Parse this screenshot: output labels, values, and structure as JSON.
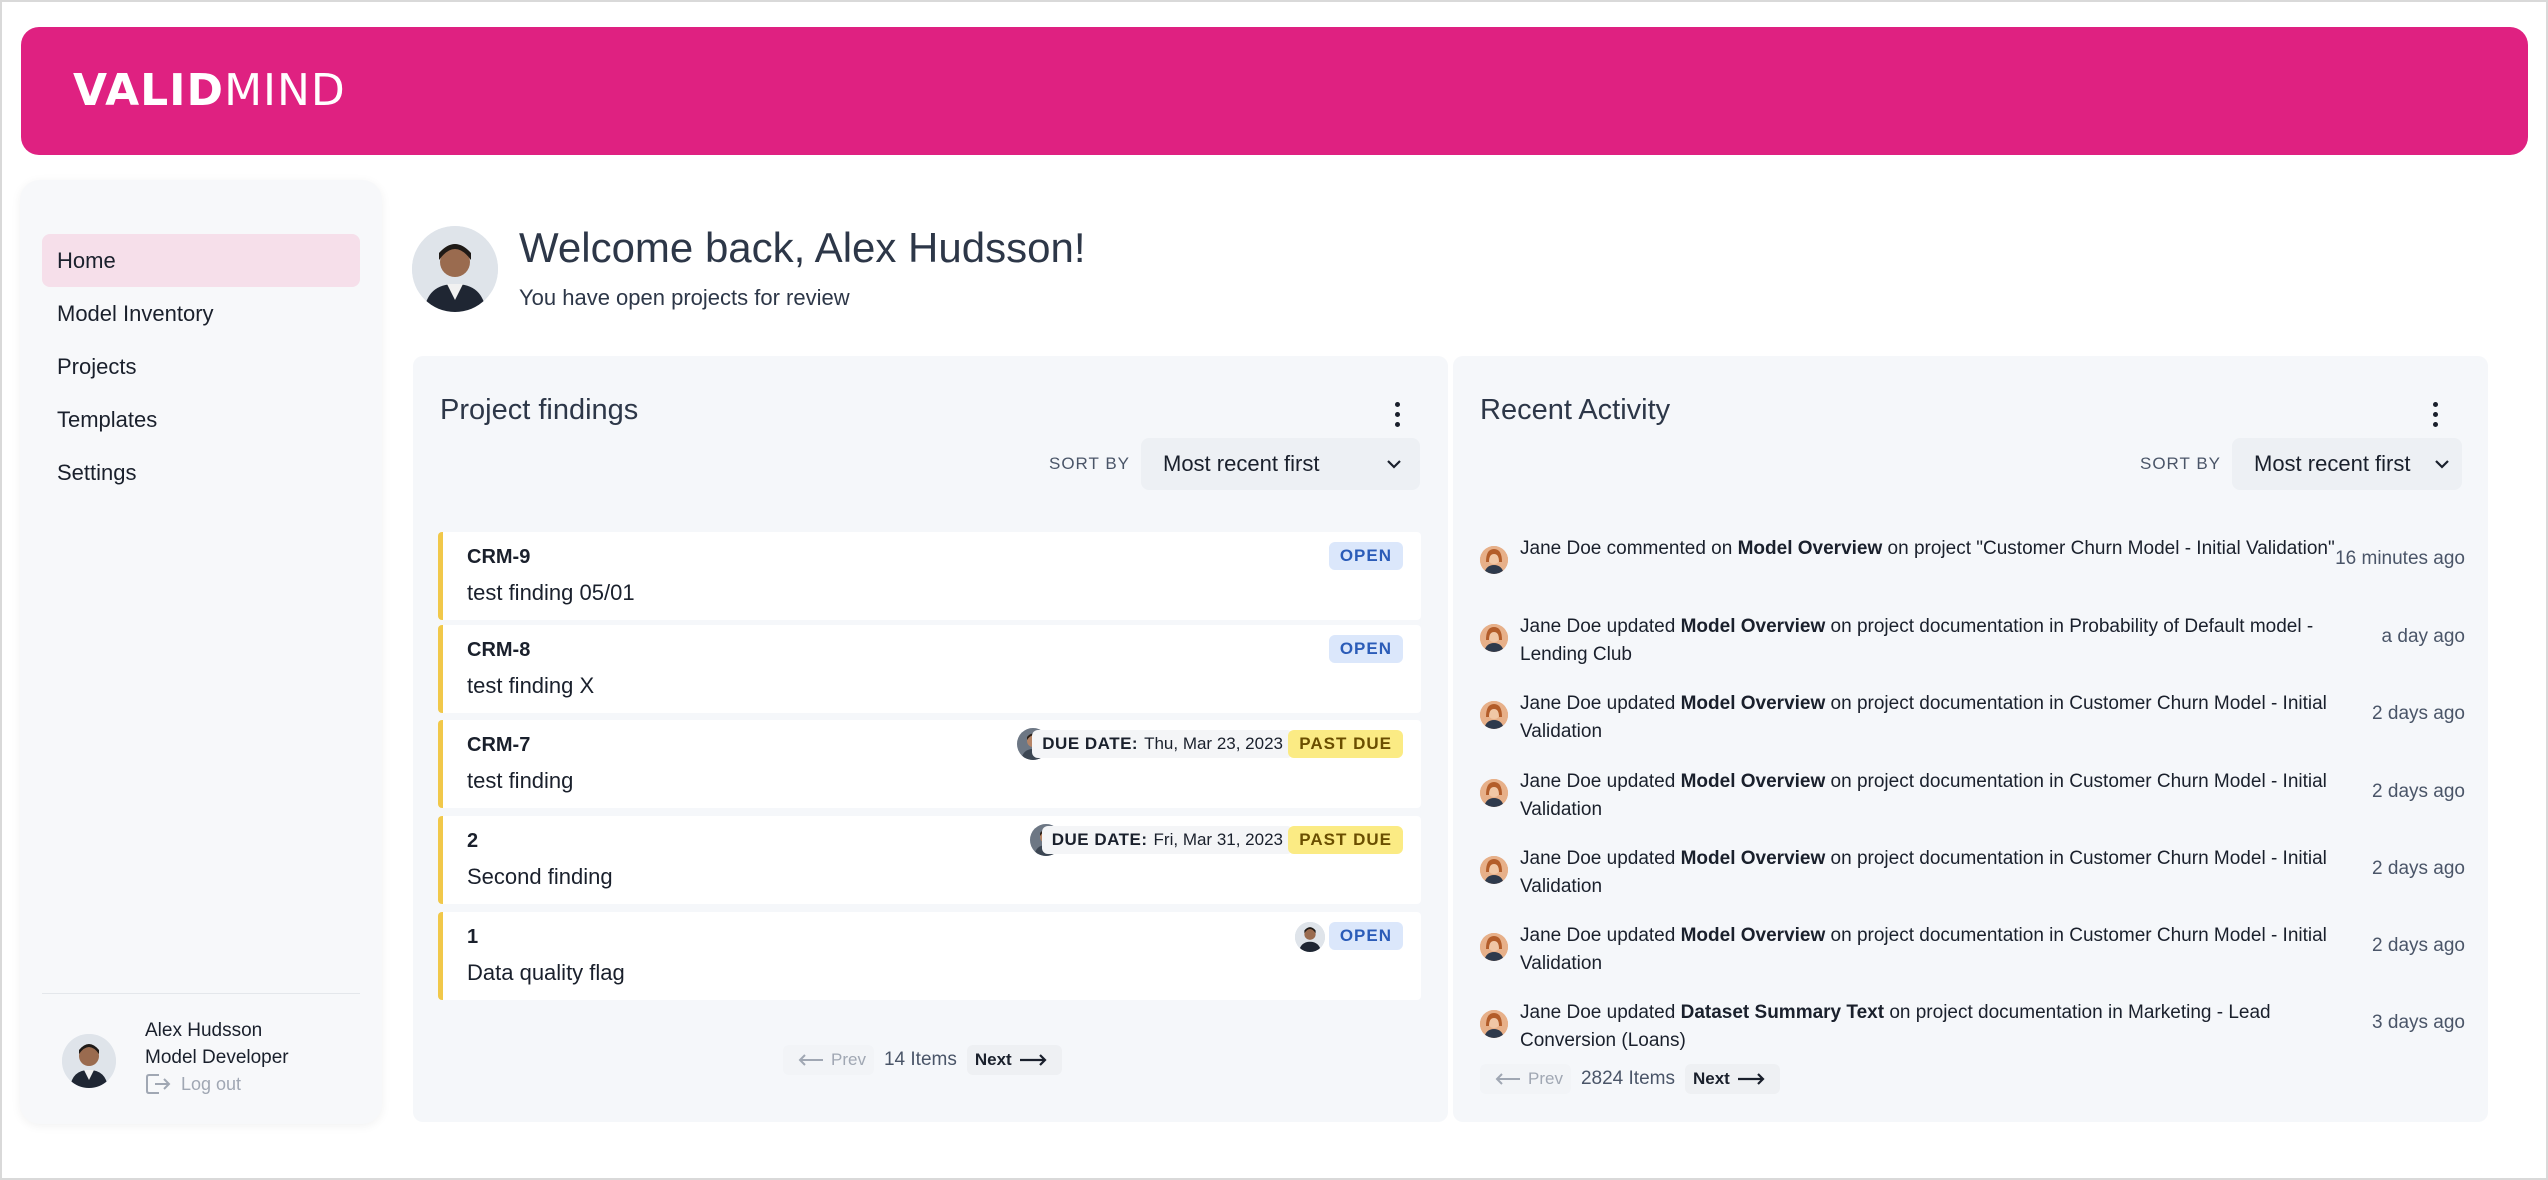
{
  "brand": {
    "logo_left": "VALID",
    "logo_right": "MIND",
    "color": "#df2181"
  },
  "sidebar": {
    "items": [
      {
        "label": "Home",
        "active": true
      },
      {
        "label": "Model Inventory",
        "active": false
      },
      {
        "label": "Projects",
        "active": false
      },
      {
        "label": "Templates",
        "active": false
      },
      {
        "label": "Settings",
        "active": false
      }
    ],
    "user": {
      "name": "Alex Hudsson",
      "role": "Model Developer",
      "logout_label": "Log out"
    }
  },
  "welcome": {
    "title": "Welcome back, Alex Hudsson!",
    "subtitle": "You have open projects for review"
  },
  "findings": {
    "title": "Project findings",
    "sort_label": "SORT BY",
    "sort_value": "Most recent first",
    "items": [
      {
        "id": "CRM-9",
        "title": "test finding 05/01",
        "status": "OPEN"
      },
      {
        "id": "CRM-8",
        "title": "test finding X",
        "status": "OPEN"
      },
      {
        "id": "CRM-7",
        "title": "test finding",
        "status": "PAST DUE",
        "due_label": "DUE DATE:",
        "due_date": "Thu, Mar 23, 2023"
      },
      {
        "id": "2",
        "title": "Second finding",
        "status": "PAST DUE",
        "due_label": "DUE DATE:",
        "due_date": "Fri, Mar 31, 2023"
      },
      {
        "id": "1",
        "title": "Data quality flag",
        "status": "OPEN"
      }
    ],
    "pager": {
      "prev": "Prev",
      "count": "14 Items",
      "next": "Next"
    }
  },
  "activity": {
    "title": "Recent Activity",
    "sort_label": "SORT BY",
    "sort_value": "Most recent first",
    "items": [
      {
        "actor": "Jane Doe",
        "verb": "commented on",
        "target": "Model Overview",
        "rest": "on project \"Customer Churn Model - Initial Validation\"",
        "time": "16 minutes ago"
      },
      {
        "actor": "Jane Doe",
        "verb": "updated",
        "target": "Model Overview",
        "rest": "on project documentation in Probability of Default model - Lending Club",
        "time": "a day ago"
      },
      {
        "actor": "Jane Doe",
        "verb": "updated",
        "target": "Model Overview",
        "rest": "on project documentation in Customer Churn Model - Initial Validation",
        "time": "2 days ago"
      },
      {
        "actor": "Jane Doe",
        "verb": "updated",
        "target": "Model Overview",
        "rest": "on project documentation in Customer Churn Model - Initial Validation",
        "time": "2 days ago"
      },
      {
        "actor": "Jane Doe",
        "verb": "updated",
        "target": "Model Overview",
        "rest": "on project documentation in Customer Churn Model - Initial Validation",
        "time": "2 days ago"
      },
      {
        "actor": "Jane Doe",
        "verb": "updated",
        "target": "Model Overview",
        "rest": "on project documentation in Customer Churn Model - Initial Validation",
        "time": "2 days ago"
      },
      {
        "actor": "Jane Doe",
        "verb": "updated",
        "target": "Dataset Summary Text",
        "rest": "on project documentation in Marketing - Lead Conversion (Loans)",
        "time": "3 days ago"
      }
    ],
    "pager": {
      "prev": "Prev",
      "count": "2824 Items",
      "next": "Next"
    }
  }
}
